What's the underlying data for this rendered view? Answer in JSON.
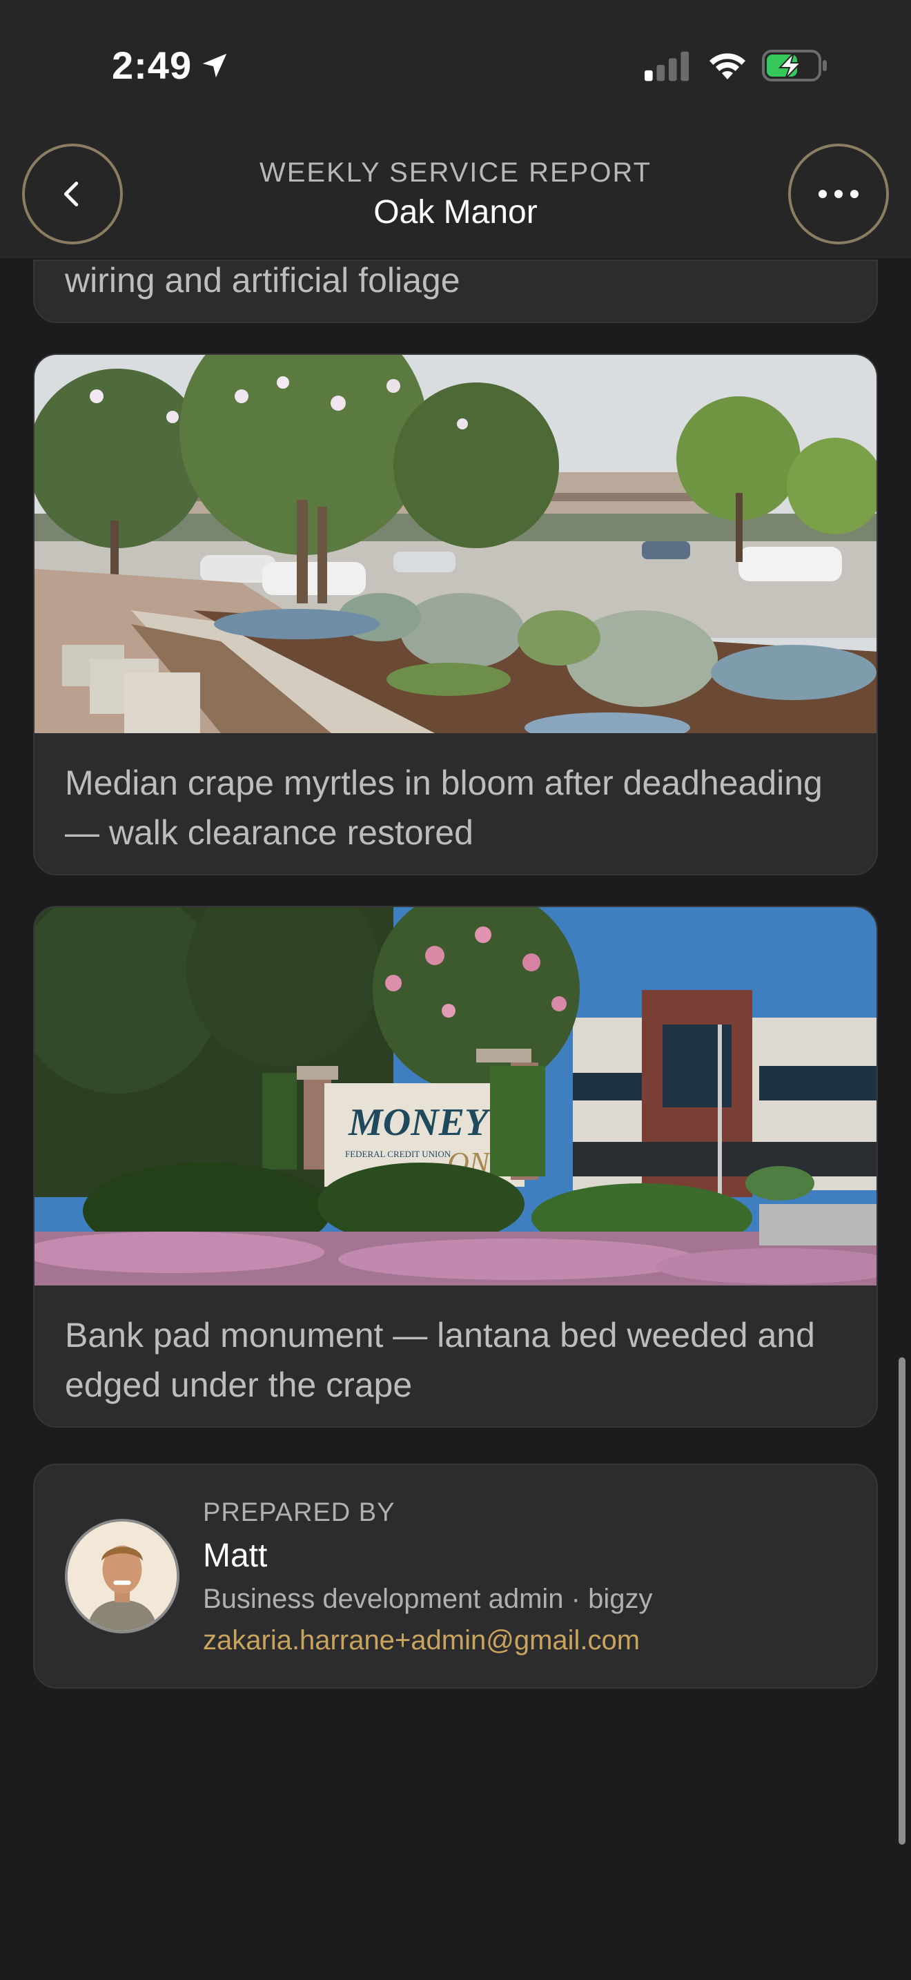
{
  "status_bar": {
    "time": "2:49",
    "location_icon": "location-arrow-icon",
    "signal_icon": "cellular-signal-icon",
    "wifi_icon": "wifi-icon",
    "battery_icon": "battery-charging-icon",
    "battery_color": "#34c759"
  },
  "header": {
    "kicker": "WEEKLY SERVICE REPORT",
    "title": "Oak Manor",
    "back_icon": "chevron-left-icon",
    "more_icon": "more-horizontal-icon"
  },
  "cards": [
    {
      "caption": "wiring and artificial foliage"
    },
    {
      "photo_icon": "landscape-photo",
      "caption": "Median crape myrtles in bloom after deadheading — walk clearance restored"
    },
    {
      "photo_icon": "landscape-photo",
      "sign_text_1": "MONEY",
      "sign_text_2": "FEDERAL CREDIT UNION",
      "sign_text_3": "ONE",
      "caption": "Bank pad monument — lantana bed weeded and edged under the crape"
    }
  ],
  "prepared_by": {
    "kicker": "PREPARED BY",
    "name": "Matt",
    "role": "Business development admin · bigzy",
    "email": "zakaria.harrane+admin@gmail.com",
    "email_color": "#c9a45c"
  },
  "theme": {
    "accent_ring": "#8a7d62",
    "background": "#1c1c1e",
    "card": "#2c2c2e"
  }
}
